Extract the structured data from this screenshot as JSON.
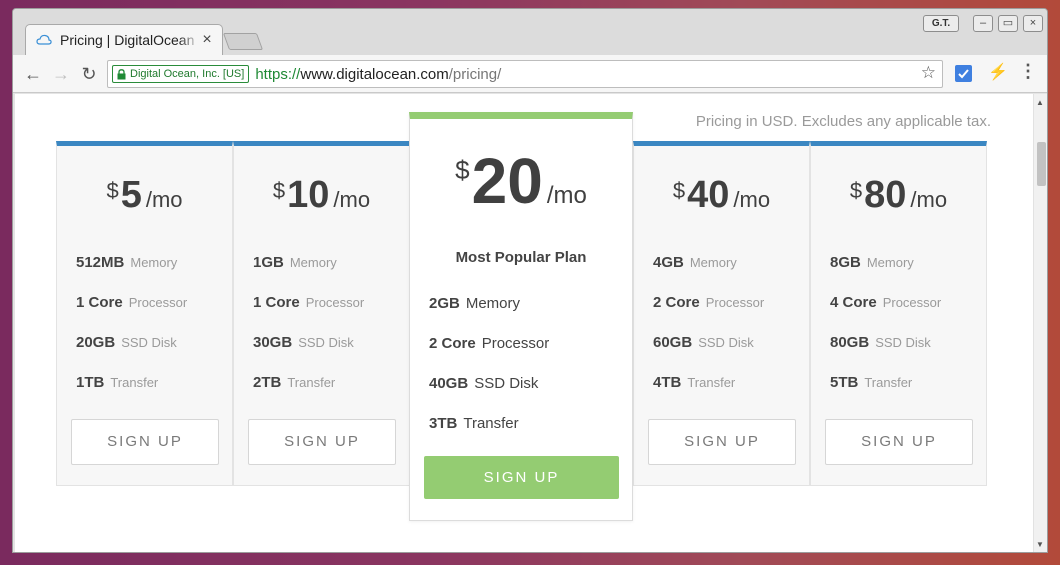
{
  "browser": {
    "tab_title": "Pricing | DigitalOcean",
    "tab_close": "×",
    "gt_label": "G.T.",
    "win_minimize": "–",
    "win_maximize": "▭",
    "win_close": "×",
    "ev_label": "Digital Ocean, Inc. [US]",
    "url_scheme": "https://",
    "url_host": "www.digitalocean.com",
    "url_path": "/pricing/",
    "back_glyph": "←",
    "forward_glyph": "→",
    "reload_glyph": "↻",
    "star_glyph": "☆",
    "bolt_glyph": "⚡",
    "menu_glyph": "⋮",
    "accent_green": "#1f8a35",
    "icons": [
      "cloud-favicon-icon",
      "lock-icon",
      "star-icon",
      "extension-icon",
      "bolt-icon",
      "menu-icon"
    ]
  },
  "page": {
    "tax_note": "Pricing in USD. Excludes any applicable tax.",
    "plan_accent": "#3b87c2",
    "featured_accent": "#94cc72",
    "plans": [
      {
        "currency": "$",
        "amount": "5",
        "per": "/mo",
        "memory": "512MB",
        "memory_label": "Memory",
        "processor": "1 Core",
        "processor_label": "Processor",
        "disk": "20GB",
        "disk_label": "SSD Disk",
        "transfer": "1TB",
        "transfer_label": "Transfer",
        "cta": "SIGN UP"
      },
      {
        "currency": "$",
        "amount": "10",
        "per": "/mo",
        "memory": "1GB",
        "memory_label": "Memory",
        "processor": "1 Core",
        "processor_label": "Processor",
        "disk": "30GB",
        "disk_label": "SSD Disk",
        "transfer": "2TB",
        "transfer_label": "Transfer",
        "cta": "SIGN UP"
      },
      {
        "currency": "$",
        "amount": "40",
        "per": "/mo",
        "memory": "4GB",
        "memory_label": "Memory",
        "processor": "2 Core",
        "processor_label": "Processor",
        "disk": "60GB",
        "disk_label": "SSD Disk",
        "transfer": "4TB",
        "transfer_label": "Transfer",
        "cta": "SIGN UP"
      },
      {
        "currency": "$",
        "amount": "80",
        "per": "/mo",
        "memory": "8GB",
        "memory_label": "Memory",
        "processor": "4 Core",
        "processor_label": "Processor",
        "disk": "80GB",
        "disk_label": "SSD Disk",
        "transfer": "5TB",
        "transfer_label": "Transfer",
        "cta": "SIGN UP"
      }
    ],
    "featured": {
      "currency": "$",
      "amount": "20",
      "per": "/mo",
      "tagline": "Most Popular Plan",
      "memory": "2GB",
      "memory_label": "Memory",
      "processor": "2 Core",
      "processor_label": "Processor",
      "disk": "40GB",
      "disk_label": "SSD Disk",
      "transfer": "3TB",
      "transfer_label": "Transfer",
      "cta": "SIGN UP"
    }
  }
}
